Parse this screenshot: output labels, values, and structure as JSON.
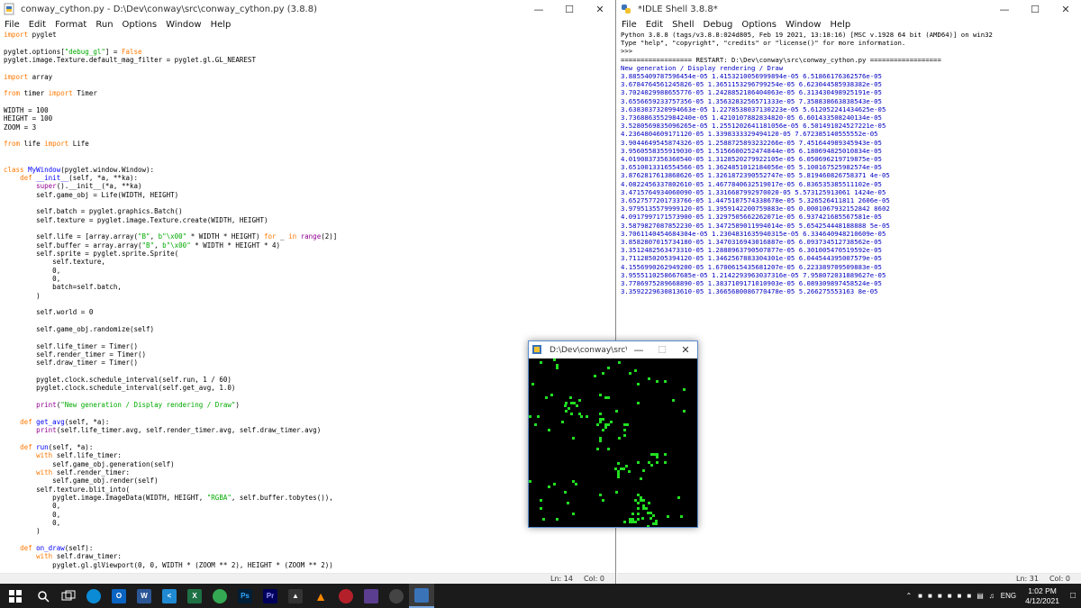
{
  "editor_window": {
    "title": "conway_cython.py - D:\\Dev\\conway\\src\\conway_cython.py (3.8.8)",
    "menus": [
      "File",
      "Edit",
      "Format",
      "Run",
      "Options",
      "Window",
      "Help"
    ],
    "code_lines": [
      "<span class='kw'>import</span> pyglet",
      "",
      "pyglet.options[<span class='str'>\"debug_gl\"</span>] = <span class='kw'>False</span>",
      "pyglet.image.Texture.default_mag_filter = pyglet.gl.GL_NEAREST",
      "",
      "<span class='kw'>import</span> array",
      "",
      "<span class='kw'>from</span> timer <span class='kw'>import</span> Timer",
      "",
      "WIDTH = 100",
      "HEIGHT = 100",
      "ZOOM = 3",
      "",
      "<span class='kw'>from</span> life <span class='kw'>import</span> Life",
      "",
      "",
      "<span class='kw'>class</span> <span class='def'>MyWindow</span>(pyglet.window.Window):",
      "    <span class='kw'>def</span> <span class='def'>__init__</span>(self, *a, **ka):",
      "        <span class='bi'>super</span>().__init__(*a, **ka)",
      "        self.game_obj = Life(WIDTH, HEIGHT)",
      "",
      "        self.batch = pyglet.graphics.Batch()",
      "        self.texture = pyglet.image.Texture.create(WIDTH, HEIGHT)",
      "",
      "        self.life = [array.array(<span class='str'>\"B\"</span>, <span class='str'>b\"\\x00\"</span> * WIDTH * HEIGHT) <span class='kw'>for</span> _ <span class='kw'>in</span> <span class='bi'>range</span>(2)]",
      "        self.buffer = array.array(<span class='str'>\"B\"</span>, <span class='str'>b\"\\x00\"</span> * WIDTH * HEIGHT * 4)",
      "        self.sprite = pyglet.sprite.Sprite(",
      "            self.texture,",
      "            0,",
      "            0,",
      "            batch=self.batch,",
      "        )",
      "",
      "        self.world = 0",
      "",
      "        self.game_obj.randomize(self)",
      "",
      "        self.life_timer = Timer()",
      "        self.render_timer = Timer()",
      "        self.draw_timer = Timer()",
      "",
      "        pyglet.clock.schedule_interval(self.run, 1 / 60)",
      "        pyglet.clock.schedule_interval(self.get_avg, 1.0)",
      "",
      "        <span class='bi'>print</span>(<span class='str'>\"New generation / Display rendering / Draw\"</span>)",
      "",
      "    <span class='kw'>def</span> <span class='def'>get_avg</span>(self, *a):",
      "        <span class='bi'>print</span>(self.life_timer.avg, self.render_timer.avg, self.draw_timer.avg)",
      "",
      "    <span class='kw'>def</span> <span class='def'>run</span>(self, *a):",
      "        <span class='kw'>with</span> self.life_timer:",
      "            self.game_obj.generation(self)",
      "        <span class='kw'>with</span> self.render_timer:",
      "            self.game_obj.render(self)",
      "        self.texture.blit_into(",
      "            pyglet.image.ImageData(WIDTH, HEIGHT, <span class='str'>\"RGBA\"</span>, self.buffer.tobytes()),",
      "            0,",
      "            0,",
      "            0,",
      "        )",
      "",
      "    <span class='kw'>def</span> <span class='def'>on_draw</span>(self):",
      "        <span class='kw'>with</span> self.draw_timer:",
      "            pyglet.gl.glViewport(0, 0, WIDTH * (ZOOM ** 2), HEIGHT * (ZOOM ** 2))"
    ],
    "status": {
      "line": "Ln: 14",
      "col": "Col: 0"
    }
  },
  "shell_window": {
    "title": "*IDLE Shell 3.8.8*",
    "menus": [
      "File",
      "Edit",
      "Shell",
      "Debug",
      "Options",
      "Window",
      "Help"
    ],
    "header_lines": [
      "Python 3.8.8 (tags/v3.8.8:024d805, Feb 19 2021, 13:18:16) [MSC v.1928 64 bit (AMD64)] on win32",
      "Type \"help\", \"copyright\", \"credits\" or \"license()\" for more information.",
      ">>> ",
      "================== RESTART: D:\\Dev\\conway\\src\\conway_cython.py =================="
    ],
    "output_lines": [
      "New generation / Display rendering / Draw",
      "3.8855409787596454e-05 1.4153210056999894e-05 6.51866176362576e-05",
      "3.6784764561245826-05 1.3651153296799254e-05 6.623044585938382e-05",
      "3.7024029988655776-05 1.2428852186404063e-05 6.313430498925191e-05",
      "3.6556659233757356-05 1.3563283256571333e-05 7.358838663838543e-05",
      "3.6383037320994663e-05 1.2278538037130223e-05 5.612052241434625e-05",
      "3.7368863552984240e-05 1.4210107882834820-05 6.601433508240134e-05",
      "3.5280569835096265e-05 1.2551202641181056e-05 6.501491024527221e-05",
      "4.2364804609171120-05 1.3398333329494120-05 7.672385140555552e-05",
      "3.9044649545874326-05 1.2588725893232266e-05 7.451644989345943e-05",
      "3.9560558355919030-05 1.5156600252474844e-05 6.180694825010834e-05",
      "4.0190837356360540-05 1.3128520279922105e-05 6.050696219719875e-05",
      "3.6510013316554566-05 1.3624851012184056e-05 5.100167525982574e-05",
      "3.8762817613868626-05 1.3261872390552747e-05 5.819460826758371 4e-05",
      "4.0822456337802610-05 1.4677840632519017e-05 6.836535385511102e-05",
      "3.4715764934060090-05 1.3316687992970020-05 5.573125913061 1424e-05",
      "3.6527577201733766-05 1.4475107574338678e-05 5.326526411811 2606e-05",
      "3.9795135579999120-05 1.3959142200759883e-05 0.0001067932152842 8602",
      "4.0917997171573900-05 1.3297505662262071e-05 6.937421685567581e-05",
      "3.5879827087852230-05 1.3472589011994014e-05 5.654254448188888 5e-05",
      "3.7061140454684304e-05 1.2304831635940315e-05 6.334640948210609e-05",
      "3.8582807015734180-05 1.3470316943016887e-05 6.093734512738562e-05",
      "3.3512482563473310-05 1.2888963790507877e-05 6.301005470519592e-05",
      "3.7112850205394120-05 1.3462567883304301e-05 6.044544395007579e-05",
      "4.1556990262949200-05 1.6700615435681207e-05 6.223389709509883e-05",
      "3.9555110258667685e-05 1.2142293963037316e-05 7.958072031889627e-05",
      "3.7786975289668890-05 1.3837109171010903e-05 6.089309897458524e-05",
      "3.3592229630813610-05 1.3665680086770478e-05 5.266275553163 8e-05"
    ],
    "status": {
      "line": "Ln: 31",
      "col": "Col: 0"
    }
  },
  "life_window": {
    "title": "D:\\Dev\\conway\\src\\co..."
  },
  "taskbar": {
    "apps": [
      "start",
      "search",
      "task-view",
      "edge",
      "outlook",
      "word",
      "vscode",
      "excel",
      "chrome",
      "photoshop",
      "premiere",
      "inkscape",
      "vlc",
      "davinci",
      "krita",
      "obs",
      "python-idle"
    ],
    "tray_text": "ENG",
    "time": "1:02 PM",
    "date": "4/12/2021"
  }
}
